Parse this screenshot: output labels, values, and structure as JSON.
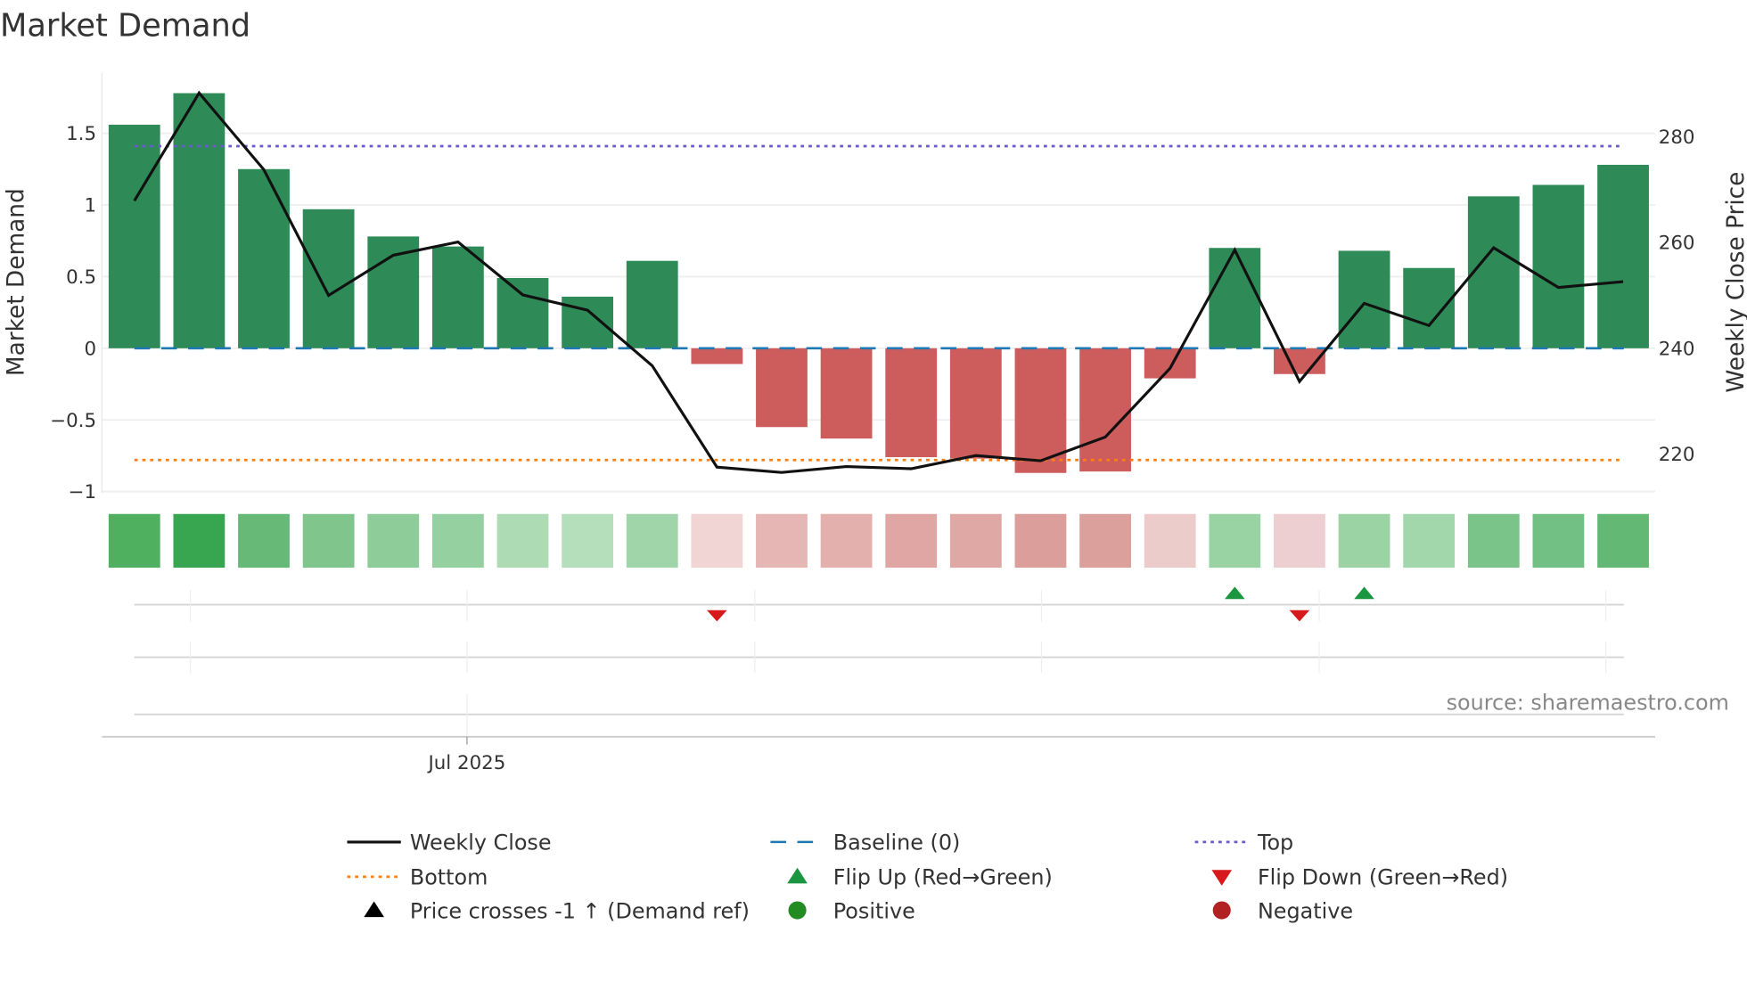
{
  "title": "Market Demand",
  "source": "source: sharemaestro.com",
  "chart_data": {
    "type": "bar",
    "title": "Market Demand",
    "ylabel": "Market Demand",
    "y2label": "Weekly Close Price",
    "ylim": [
      -1.1,
      1.95
    ],
    "y2lim": [
      207.5,
      302.1
    ],
    "yticks": [
      {
        "v": 1.5,
        "label": "1.5"
      },
      {
        "v": 1,
        "label": "1"
      },
      {
        "v": 0.5,
        "label": "0.5"
      },
      {
        "v": 0,
        "label": "0"
      },
      {
        "v": -0.5,
        "label": "−0.5"
      },
      {
        "v": -1,
        "label": "−1"
      }
    ],
    "y2ticks": [
      {
        "v": 280,
        "label": "280"
      },
      {
        "v": 260,
        "label": "260"
      },
      {
        "v": 240,
        "label": "240"
      },
      {
        "v": 220,
        "label": "220"
      }
    ],
    "xticks": [
      {
        "index": 5.2,
        "label": "Jul 2025"
      }
    ],
    "demand": [
      1.56,
      1.78,
      1.25,
      0.97,
      0.78,
      0.71,
      0.49,
      0.36,
      0.61,
      -0.11,
      -0.55,
      -0.63,
      -0.76,
      -0.77,
      -0.87,
      -0.86,
      -0.21,
      0.7,
      -0.18,
      0.68,
      0.56,
      1.06,
      1.14,
      1.28
    ],
    "weekly_close": [
      267.9,
      288.3,
      273.8,
      250.0,
      257.6,
      260.1,
      250.1,
      247.2,
      236.7,
      217.5,
      216.5,
      217.6,
      217.2,
      219.7,
      218.7,
      223.2,
      236.2,
      258.6,
      233.7,
      248.5,
      244.3,
      259.0,
      251.5,
      252.6
    ],
    "strip_colors": [
      "#4fb060",
      "#38a650",
      "#67b977",
      "#7fc58c",
      "#8ecd99",
      "#95d0a0",
      "#acdbb4",
      "#b5dfbb",
      "#a0d5a9",
      "#f0d5d4",
      "#e6b6b5",
      "#e3b0ae",
      "#dfa6a4",
      "#dfa8a5",
      "#db9e9b",
      "#dca09c",
      "#ecccca",
      "#9ad3a3",
      "#eecfd1",
      "#9bd3a4",
      "#a2d7ab",
      "#7ac489",
      "#72c083",
      "#63b874"
    ],
    "top": 1.41,
    "bottom": -0.78,
    "baseline": 0,
    "flip_up": [
      17,
      19
    ],
    "flip_down": [
      9,
      18
    ],
    "colors": {
      "positive_bar": "#2e8b57",
      "negative_bar": "#cd5c5c",
      "line": "#111111",
      "baseline": "#1f77b4",
      "top": "#6a5acd",
      "bottom": "#ff7f0e",
      "flip_up": "#1a9641",
      "flip_down": "#d7191c",
      "positive": "#228b22",
      "negative": "#b22222"
    },
    "legend": [
      {
        "label": "Weekly Close",
        "symbol": "line"
      },
      {
        "label": "Baseline (0)",
        "symbol": "dash"
      },
      {
        "label": "Top",
        "symbol": "dot-purple"
      },
      {
        "label": "Bottom",
        "symbol": "dot-orange"
      },
      {
        "label": "Flip Up (Red→Green)",
        "symbol": "tri-up-green"
      },
      {
        "label": "Flip Down (Green→Red)",
        "symbol": "tri-down-red"
      },
      {
        "label": "Price crosses -1 ↑ (Demand ref)",
        "symbol": "tri-up-black"
      },
      {
        "label": "Positive",
        "symbol": "circle-green"
      },
      {
        "label": "Negative",
        "symbol": "circle-red"
      }
    ]
  }
}
